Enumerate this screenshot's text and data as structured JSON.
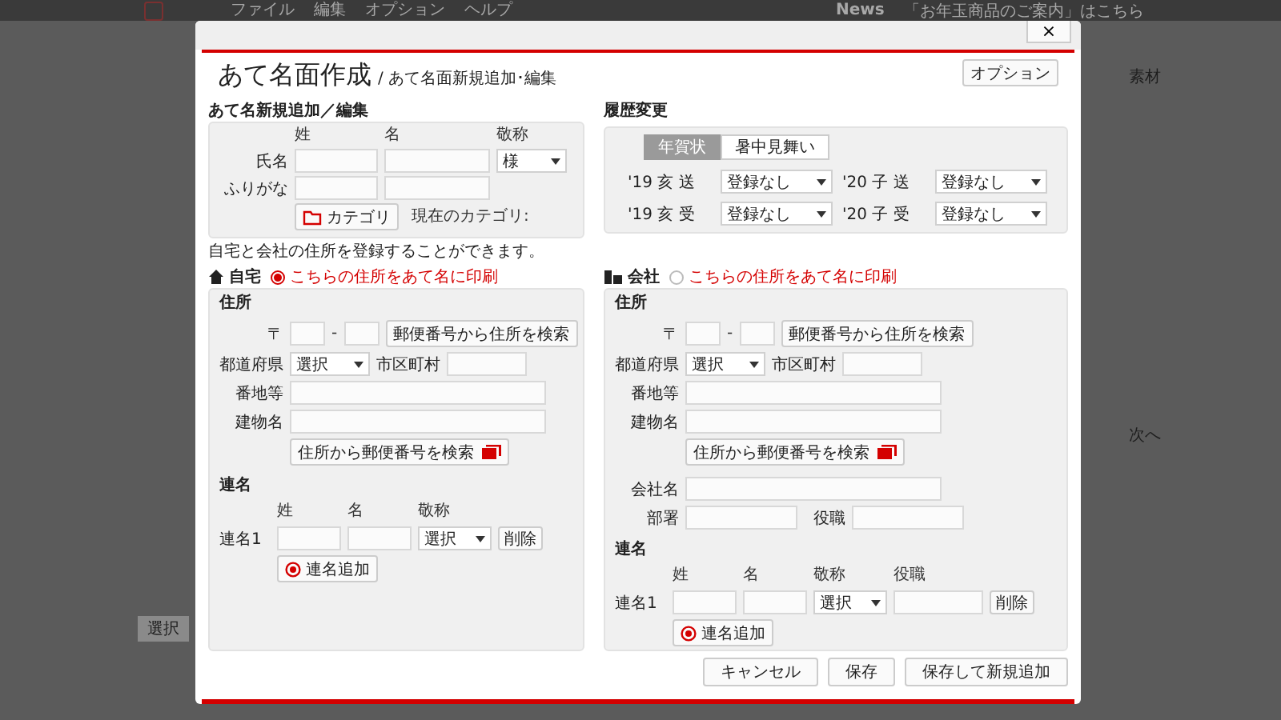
{
  "background_app": {
    "menu": [
      "ファイル",
      "編集",
      "オプション",
      "ヘルプ"
    ],
    "news_label": "News",
    "news_text": "「お年玉商品のご案内」はこちら",
    "left_labels": [
      "選択"
    ],
    "right_labels": [
      "素材",
      "次へ"
    ]
  },
  "dialog": {
    "close_label": "×",
    "title": "あて名面作成",
    "subtitle": "/ あて名面新規追加･編集",
    "option_button": "オプション"
  },
  "name_edit": {
    "heading": "あて名新規追加／編集",
    "columns": [
      "姓",
      "名",
      "敬称"
    ],
    "rows": [
      {
        "label": "氏名",
        "honorific": "様"
      },
      {
        "label": "ふりがな"
      }
    ],
    "category_button": "カテゴリ",
    "category_text": "現在のカテゴリ:"
  },
  "history": {
    "heading": "履歴変更",
    "tabs": [
      {
        "label": "年賀状",
        "selected": true
      },
      {
        "label": "暑中見舞い",
        "selected": false
      }
    ],
    "rows": [
      {
        "label": "'19 亥 送",
        "value": "登録なし"
      },
      {
        "label": "'20 子 送",
        "value": "登録なし"
      },
      {
        "label": "'19 亥 受",
        "value": "登録なし"
      },
      {
        "label": "'20 子 受",
        "value": "登録なし"
      }
    ]
  },
  "note": "自宅と会社の住所を登録することができます。",
  "addresses": [
    {
      "kind": "home",
      "title": "自宅",
      "print_selected": true,
      "print_label": "こちらの住所をあて名に印刷",
      "section_title": "住所",
      "postal_mark": "〒",
      "postal_dash": "-",
      "postal_search": "郵便番号から住所を検索",
      "prefecture_label": "都道府県",
      "prefecture_value": "選択",
      "city_label": "市区町村",
      "street_label": "番地等",
      "building_label": "建物名",
      "zip_search": "住所から郵便番号を検索",
      "joint": {
        "heading": "連名",
        "columns": [
          "姓",
          "名",
          "敬称"
        ],
        "row_label": "連名1",
        "honorific": "選択",
        "delete": "削除",
        "add": "連名追加"
      }
    },
    {
      "kind": "company",
      "title": "会社",
      "print_selected": false,
      "print_label": "こちらの住所をあて名に印刷",
      "section_title": "住所",
      "postal_mark": "〒",
      "postal_dash": "-",
      "postal_search": "郵便番号から住所を検索",
      "prefecture_label": "都道府県",
      "prefecture_value": "選択",
      "city_label": "市区町村",
      "street_label": "番地等",
      "building_label": "建物名",
      "zip_search": "住所から郵便番号を検索",
      "company_name_label": "会社名",
      "department_label": "部署",
      "position_label": "役職",
      "joint": {
        "heading": "連名",
        "columns": [
          "姓",
          "名",
          "敬称",
          "役職"
        ],
        "row_label": "連名1",
        "honorific": "選択",
        "delete": "削除",
        "add": "連名追加"
      }
    }
  ],
  "footer": {
    "buttons": [
      "キャンセル",
      "保存",
      "保存して新規追加"
    ]
  }
}
